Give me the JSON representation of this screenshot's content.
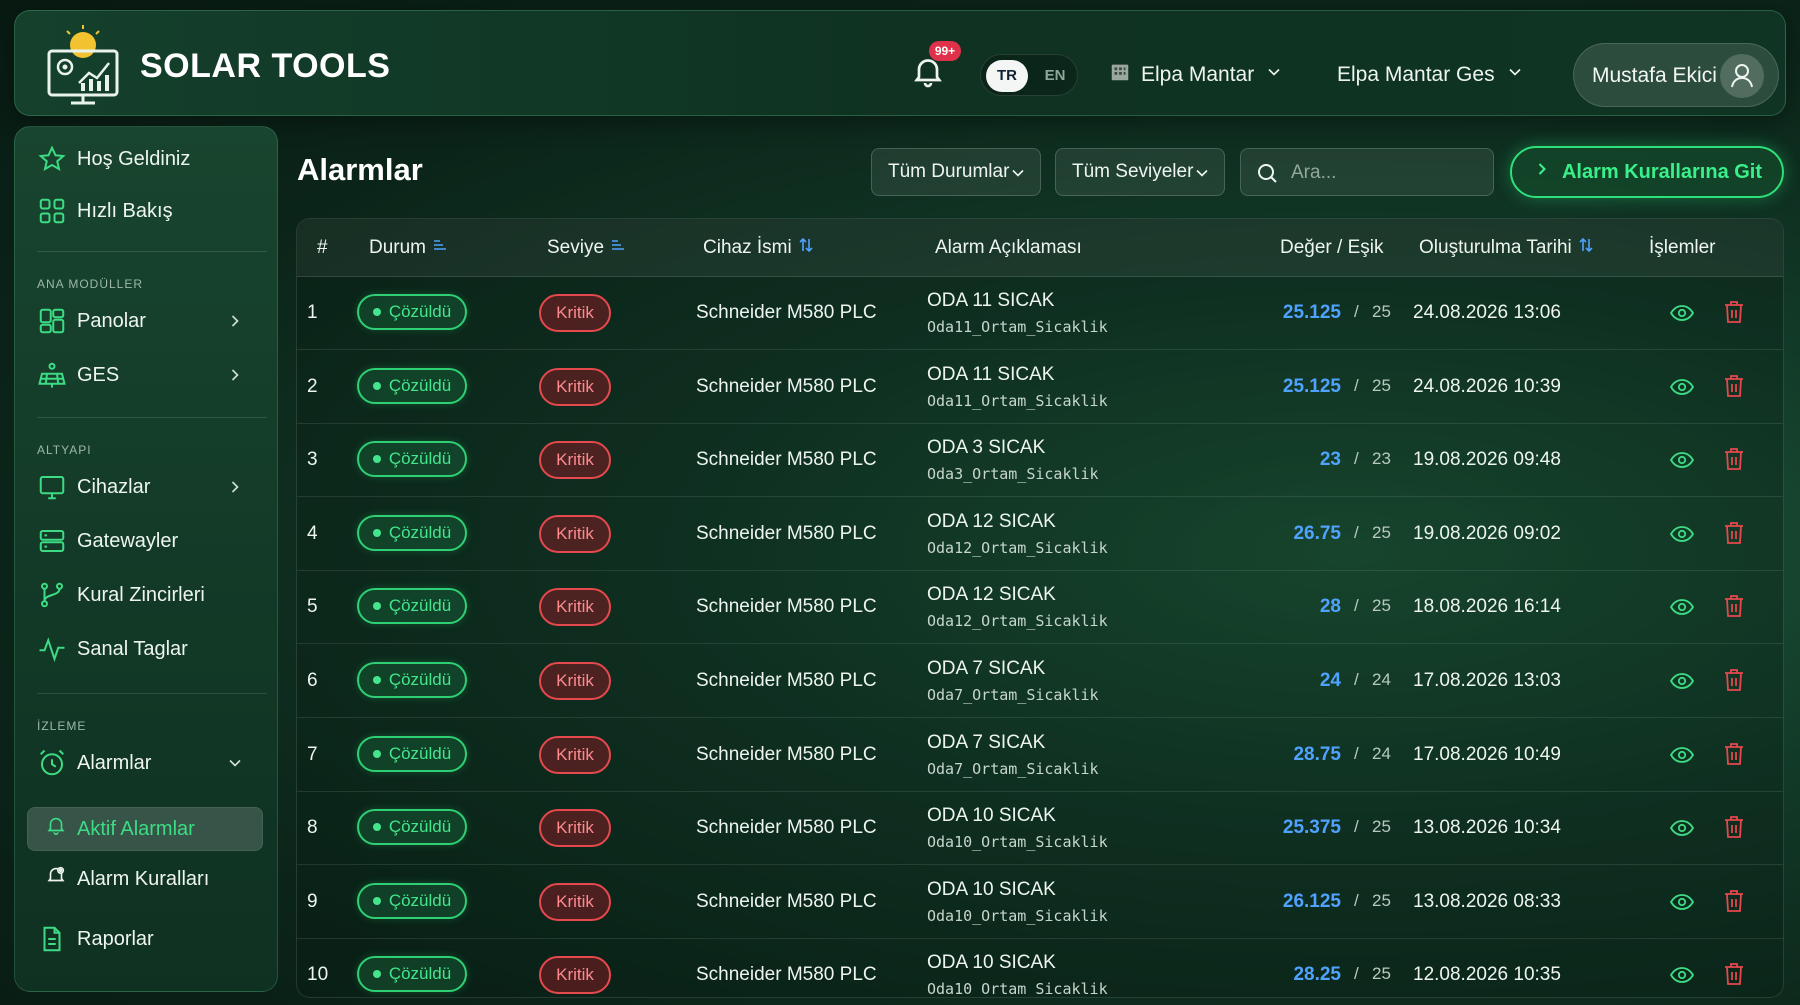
{
  "brand": {
    "name": "SOLAR TOOLS"
  },
  "header": {
    "notification_badge": "99+",
    "lang_tr": "TR",
    "lang_en": "EN",
    "company_select": "Elpa Mantar",
    "plant_select": "Elpa Mantar Ges",
    "user_name": "Mustafa Ekici"
  },
  "sidebar": {
    "welcome": "Hoş Geldiniz",
    "quick_view": "Hızlı Bakış",
    "section_main": "ANA MODÜLLER",
    "panels": "Panolar",
    "ges": "GES",
    "section_infra": "ALTYAPI",
    "devices": "Cihazlar",
    "gateways": "Gatewayler",
    "rule_chains": "Kural Zincirleri",
    "virtual_tags": "Sanal Taglar",
    "section_monitor": "İZLEME",
    "alarms": "Alarmlar",
    "active_alarms": "Aktif Alarmlar",
    "alarm_rules": "Alarm Kuralları",
    "reports": "Raporlar"
  },
  "page": {
    "title": "Alarmlar",
    "filter_status": "Tüm Durumlar",
    "filter_level": "Tüm Seviyeler",
    "search_placeholder": "Ara...",
    "go_rules_button": "Alarm Kurallarına Git"
  },
  "table": {
    "headers": {
      "num": "#",
      "status": "Durum",
      "level": "Seviye",
      "device": "Cihaz İsmi",
      "description": "Alarm Açıklaması",
      "value_threshold": "Değer / Eşik",
      "created": "Oluşturulma Tarihi",
      "actions": "İşlemler"
    },
    "separator": "/",
    "rows": [
      {
        "num": "1",
        "status": "Çözüldü",
        "level": "Kritik",
        "device": "Schneider M580 PLC",
        "alarm": "ODA 11 SICAK",
        "tag": "Oda11_Ortam_Sicaklik",
        "value": "25.125",
        "threshold": "25",
        "date": "24.08.2026 13:06"
      },
      {
        "num": "2",
        "status": "Çözüldü",
        "level": "Kritik",
        "device": "Schneider M580 PLC",
        "alarm": "ODA 11 SICAK",
        "tag": "Oda11_Ortam_Sicaklik",
        "value": "25.125",
        "threshold": "25",
        "date": "24.08.2026 10:39"
      },
      {
        "num": "3",
        "status": "Çözüldü",
        "level": "Kritik",
        "device": "Schneider M580 PLC",
        "alarm": "ODA 3 SICAK",
        "tag": "Oda3_Ortam_Sicaklik",
        "value": "23",
        "threshold": "23",
        "date": "19.08.2026 09:48"
      },
      {
        "num": "4",
        "status": "Çözüldü",
        "level": "Kritik",
        "device": "Schneider M580 PLC",
        "alarm": "ODA 12 SICAK",
        "tag": "Oda12_Ortam_Sicaklik",
        "value": "26.75",
        "threshold": "25",
        "date": "19.08.2026 09:02"
      },
      {
        "num": "5",
        "status": "Çözüldü",
        "level": "Kritik",
        "device": "Schneider M580 PLC",
        "alarm": "ODA 12 SICAK",
        "tag": "Oda12_Ortam_Sicaklik",
        "value": "28",
        "threshold": "25",
        "date": "18.08.2026 16:14"
      },
      {
        "num": "6",
        "status": "Çözüldü",
        "level": "Kritik",
        "device": "Schneider M580 PLC",
        "alarm": "ODA 7 SICAK",
        "tag": "Oda7_Ortam_Sicaklik",
        "value": "24",
        "threshold": "24",
        "date": "17.08.2026 13:03"
      },
      {
        "num": "7",
        "status": "Çözüldü",
        "level": "Kritik",
        "device": "Schneider M580 PLC",
        "alarm": "ODA 7 SICAK",
        "tag": "Oda7_Ortam_Sicaklik",
        "value": "28.75",
        "threshold": "24",
        "date": "17.08.2026 10:49"
      },
      {
        "num": "8",
        "status": "Çözüldü",
        "level": "Kritik",
        "device": "Schneider M580 PLC",
        "alarm": "ODA 10 SICAK",
        "tag": "Oda10_Ortam_Sicaklik",
        "value": "25.375",
        "threshold": "25",
        "date": "13.08.2026 10:34"
      },
      {
        "num": "9",
        "status": "Çözüldü",
        "level": "Kritik",
        "device": "Schneider M580 PLC",
        "alarm": "ODA 10 SICAK",
        "tag": "Oda10_Ortam_Sicaklik",
        "value": "26.125",
        "threshold": "25",
        "date": "13.08.2026 08:33"
      },
      {
        "num": "10",
        "status": "Çözüldü",
        "level": "Kritik",
        "device": "Schneider M580 PLC",
        "alarm": "ODA 10 SICAK",
        "tag": "Oda10_Ortam_Sicaklik",
        "value": "28.25",
        "threshold": "25",
        "date": "12.08.2026 10:35"
      }
    ]
  },
  "colors": {
    "accent_green": "#2ee07a",
    "value_blue": "#4fa3ff",
    "critical_red": "#e5484d",
    "delete_red": "#e5484d"
  }
}
